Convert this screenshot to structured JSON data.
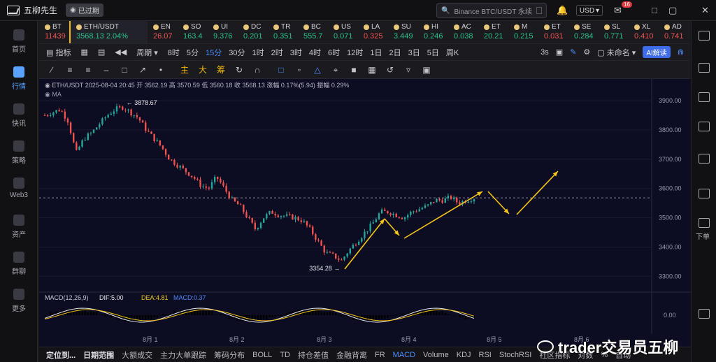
{
  "app": {
    "name": "五柳先生",
    "status": "已过期"
  },
  "search": {
    "text": "Binance BTC/USDT 永续"
  },
  "currency": "USD",
  "notif_count": "16",
  "nav": [
    {
      "label": "首页",
      "icon": "home-icon"
    },
    {
      "label": "行情",
      "icon": "market-icon",
      "active": true
    },
    {
      "label": "快讯",
      "icon": "news-icon"
    },
    {
      "label": "策略",
      "icon": "robot-icon"
    },
    {
      "label": "Web3",
      "icon": "web3-icon"
    },
    {
      "label": "资产",
      "icon": "wallet-icon"
    },
    {
      "label": "群聊",
      "icon": "chat-icon"
    },
    {
      "label": "更多",
      "icon": "more-icon"
    }
  ],
  "right_nav": {
    "download": "下单"
  },
  "tickers": [
    {
      "sym": "BT",
      "price": "11439",
      "dir": "dn"
    },
    {
      "sym": "ETH/USDT",
      "price": "3568.13",
      "change": "2.04%",
      "dir": "up",
      "active": true
    },
    {
      "sym": "EN",
      "price": "26.07",
      "dir": "dn"
    },
    {
      "sym": "SO",
      "price": "163.4",
      "dir": "up"
    },
    {
      "sym": "UI",
      "price": "9.376",
      "dir": "up"
    },
    {
      "sym": "DC",
      "price": "0.201",
      "dir": "up"
    },
    {
      "sym": "TR",
      "price": "0.351",
      "dir": "up"
    },
    {
      "sym": "BC",
      "price": "555.7",
      "dir": "up"
    },
    {
      "sym": "US",
      "price": "0.071",
      "dir": "up"
    },
    {
      "sym": "LA",
      "price": "0.325",
      "dir": "dn"
    },
    {
      "sym": "SU",
      "price": "3.449",
      "dir": "up"
    },
    {
      "sym": "HI",
      "price": "0.246",
      "dir": "up"
    },
    {
      "sym": "AC",
      "price": "0.038",
      "dir": "up"
    },
    {
      "sym": "ET",
      "price": "20.21",
      "dir": "up"
    },
    {
      "sym": "M",
      "price": "0.215",
      "dir": "up"
    },
    {
      "sym": "ET",
      "price": "0.031",
      "dir": "dn"
    },
    {
      "sym": "SE",
      "price": "0.284",
      "dir": "up"
    },
    {
      "sym": "SL",
      "price": "0.771",
      "dir": "up"
    },
    {
      "sym": "XL",
      "price": "0.410",
      "dir": "dn"
    },
    {
      "sym": "AD",
      "price": "0.741",
      "dir": "dn"
    }
  ],
  "toolbar1": {
    "indicator": "指标",
    "period": "周期",
    "intervals": [
      "8时",
      "5分",
      "15分",
      "30分",
      "1时",
      "2时",
      "3时",
      "4时",
      "6时",
      "12时",
      "1日",
      "2日",
      "3日",
      "5日",
      "周K"
    ],
    "active_interval": "15分",
    "replay": "3s",
    "layout": "未命名",
    "ai": "AI解读"
  },
  "toolbar2": {
    "labels": [
      "主",
      "大",
      "筹"
    ]
  },
  "chart_header": {
    "pair": "ETH/USDT",
    "time": "2025-08-04 20:45",
    "open_label": "开",
    "open": "3562.19",
    "high_label": "高",
    "high": "3570.59",
    "low_label": "低",
    "low": "3560.18",
    "close_label": "收",
    "close": "3568.13",
    "chg_label": "涨幅",
    "chg": "0.17%(5.94)",
    "amp_label": "振幅",
    "amp": "0.29%",
    "ma": "MA"
  },
  "macd_header": {
    "name": "MACD(12,26,9)",
    "dif": "DIF:5.00",
    "dea": "DEA:4.81",
    "macd": "MACD:0.37"
  },
  "annotations": {
    "high": "3878.67",
    "low": "3354.28"
  },
  "chart_data": {
    "type": "candlestick",
    "y_axis": [
      "3900.00",
      "3800.00",
      "3700.00",
      "3600.00",
      "3500.00",
      "3400.00",
      "3300.00"
    ],
    "ylim": [
      3270,
      3950
    ],
    "macd_axis": "0.00",
    "x_axis": [
      "8月 1",
      "8月 2",
      "8月 3",
      "8月 4",
      "8月 5",
      "8月 6"
    ],
    "current_price": 3568,
    "close_path": [
      [
        0,
        3850
      ],
      [
        2,
        3860
      ],
      [
        4,
        3870
      ],
      [
        6,
        3830
      ],
      [
        8,
        3720
      ],
      [
        10,
        3770
      ],
      [
        12,
        3790
      ],
      [
        14,
        3820
      ],
      [
        16,
        3850
      ],
      [
        18,
        3870
      ],
      [
        20,
        3878
      ],
      [
        22,
        3860
      ],
      [
        24,
        3840
      ],
      [
        26,
        3800
      ],
      [
        28,
        3770
      ],
      [
        30,
        3740
      ],
      [
        32,
        3700
      ],
      [
        34,
        3680
      ],
      [
        36,
        3660
      ],
      [
        38,
        3640
      ],
      [
        40,
        3610
      ],
      [
        42,
        3600
      ],
      [
        44,
        3640
      ],
      [
        46,
        3600
      ],
      [
        48,
        3560
      ],
      [
        50,
        3540
      ],
      [
        52,
        3500
      ],
      [
        54,
        3460
      ],
      [
        56,
        3500
      ],
      [
        58,
        3520
      ],
      [
        60,
        3510
      ],
      [
        62,
        3505
      ],
      [
        64,
        3500
      ],
      [
        66,
        3490
      ],
      [
        68,
        3460
      ],
      [
        70,
        3420
      ],
      [
        72,
        3380
      ],
      [
        74,
        3370
      ],
      [
        76,
        3354
      ],
      [
        78,
        3390
      ],
      [
        80,
        3420
      ],
      [
        82,
        3450
      ],
      [
        84,
        3480
      ],
      [
        86,
        3520
      ],
      [
        88,
        3520
      ],
      [
        90,
        3510
      ],
      [
        92,
        3500
      ],
      [
        94,
        3520
      ],
      [
        96,
        3530
      ],
      [
        98,
        3540
      ],
      [
        100,
        3560
      ],
      [
        102,
        3560
      ],
      [
        104,
        3570
      ],
      [
        106,
        3550
      ],
      [
        108,
        3560
      ],
      [
        110,
        3568
      ]
    ]
  },
  "watermark": "trader交易员五柳",
  "bottom": {
    "items": [
      "定位到...",
      "日期范围",
      "大额成交",
      "主力大单跟踪",
      "筹码分布",
      "BOLL",
      "TD",
      "持仓差值",
      "金融背离",
      "FR",
      "MACD",
      "Volume",
      "KDJ",
      "RSI",
      "StochRSI",
      "社区指标",
      "对数",
      "%",
      "自动"
    ],
    "active": "MACD"
  }
}
